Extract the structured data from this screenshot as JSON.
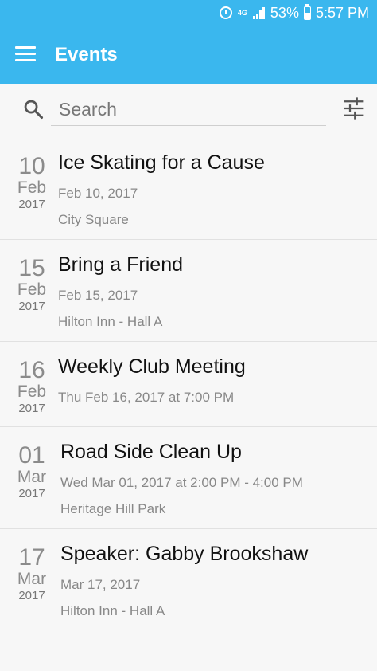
{
  "status_bar": {
    "network": "4G",
    "battery_level": 0.53,
    "battery": "53%",
    "time": "5:57 PM"
  },
  "app_bar": {
    "title": "Events"
  },
  "search": {
    "placeholder": "Search"
  },
  "events": [
    {
      "day": "10",
      "month": "Feb",
      "year": "2017",
      "title": "Ice Skating for a Cause",
      "date": "Feb 10, 2017",
      "location": "City Square"
    },
    {
      "day": "15",
      "month": "Feb",
      "year": "2017",
      "title": "Bring a Friend",
      "date": "Feb 15, 2017",
      "location": "Hilton Inn - Hall A"
    },
    {
      "day": "16",
      "month": "Feb",
      "year": "2017",
      "title": "Weekly Club Meeting",
      "date": "Thu Feb 16, 2017 at 7:00 PM"
    },
    {
      "day": "01",
      "month": "Mar",
      "year": "2017",
      "title": "Road Side Clean Up",
      "date": "Wed Mar 01, 2017 at 2:00 PM  - 4:00 PM",
      "location": "Heritage Hill Park"
    },
    {
      "day": "17",
      "month": "Mar",
      "year": "2017",
      "title": "Speaker: Gabby Brookshaw",
      "date": "Mar 17, 2017",
      "location": "Hilton Inn - Hall A"
    }
  ]
}
